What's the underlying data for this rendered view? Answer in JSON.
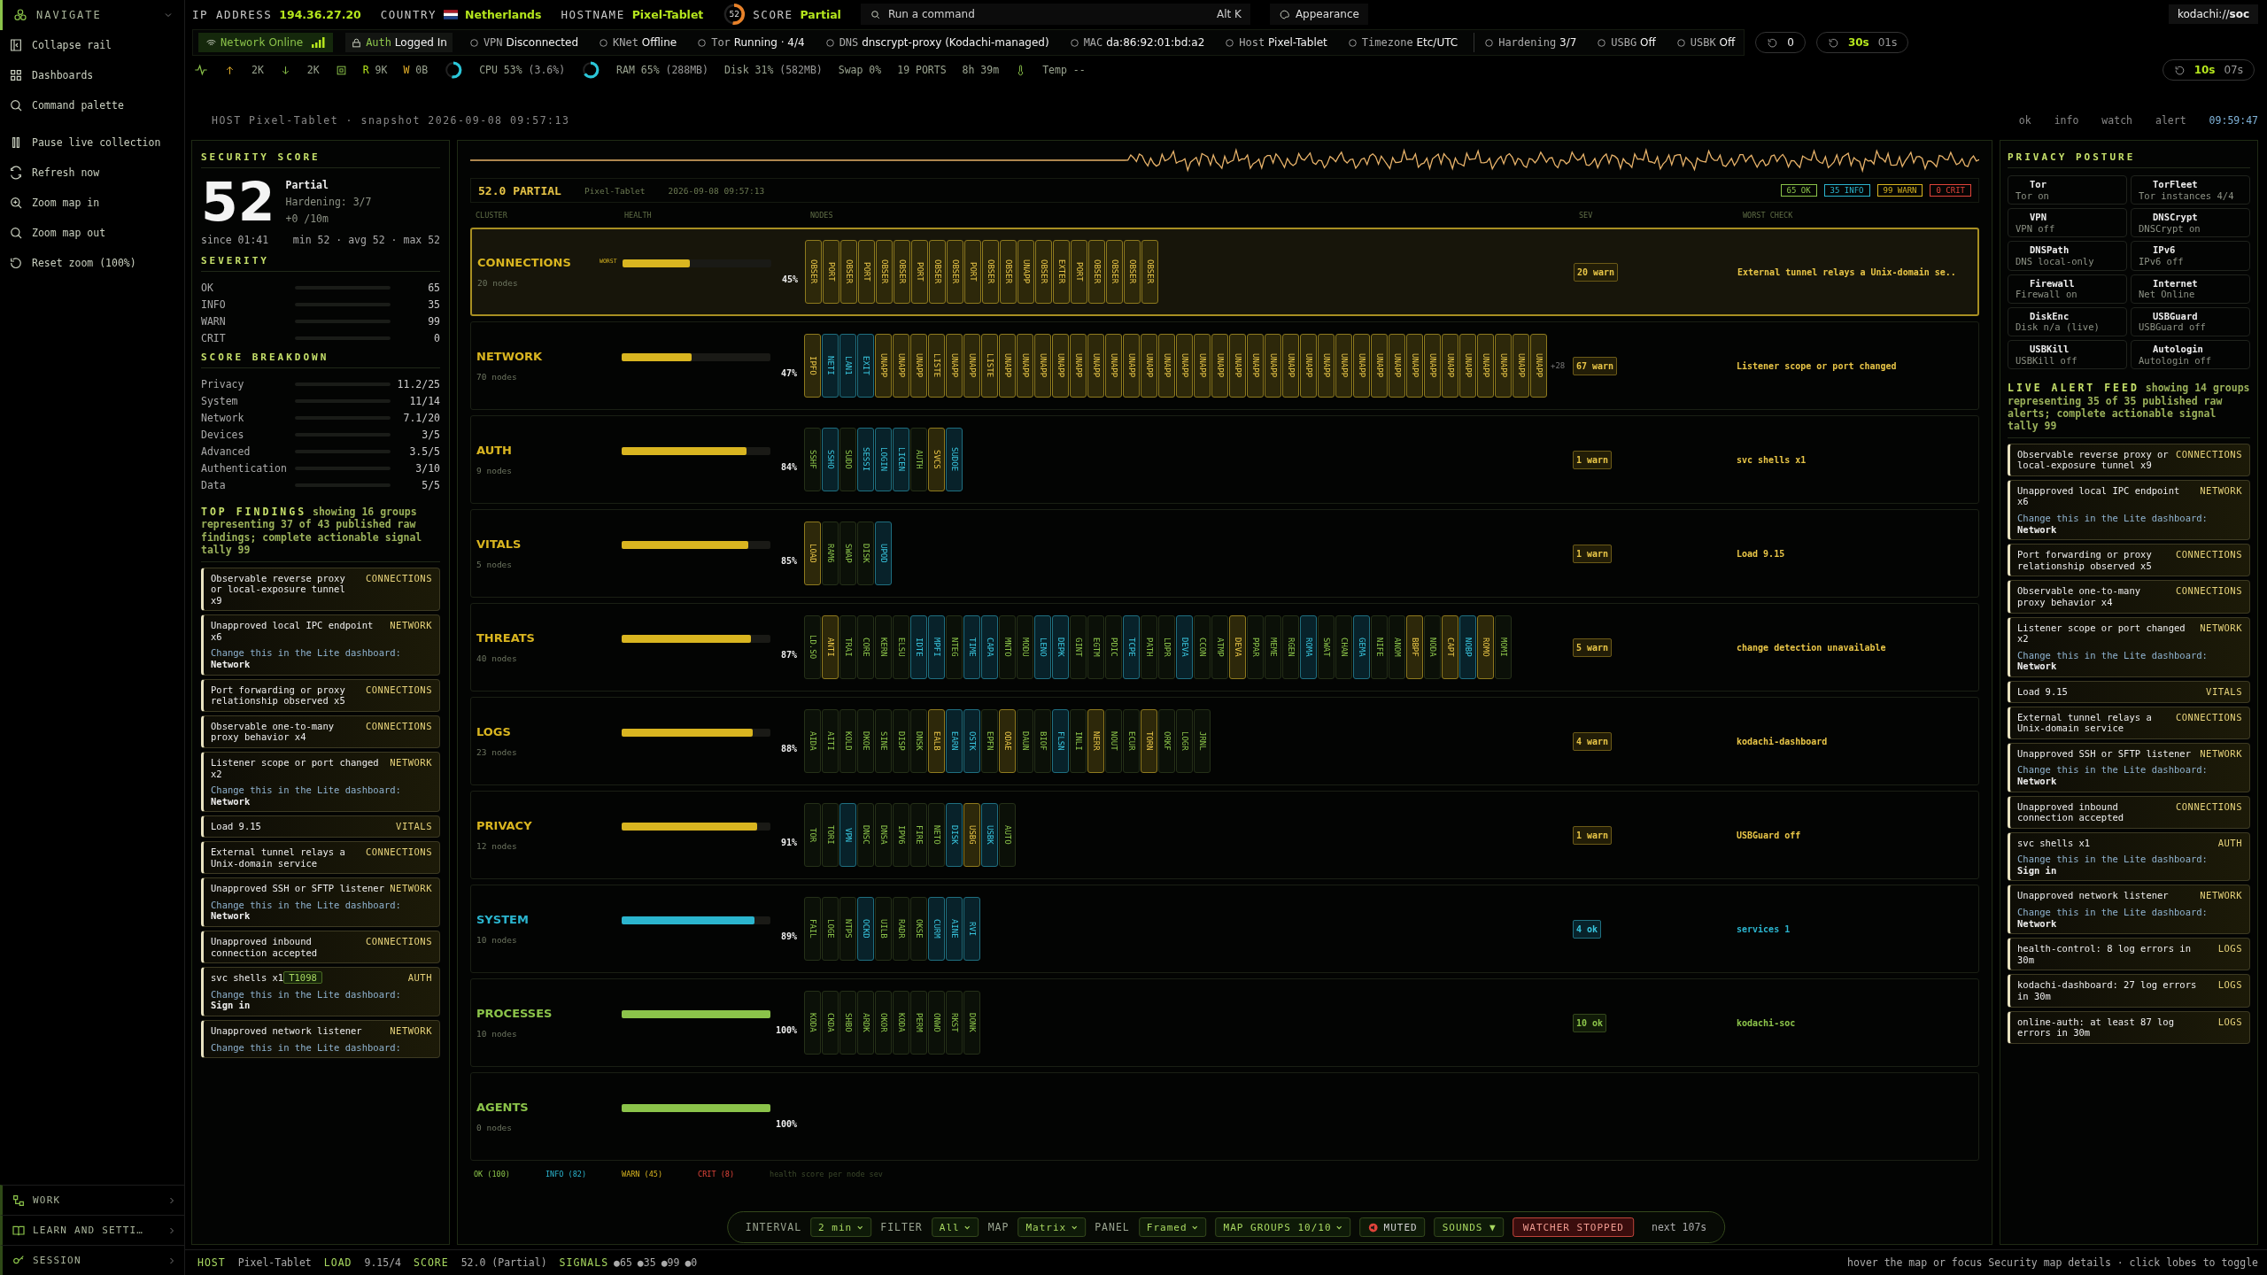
{
  "nav": {
    "title": "NAVIGATE",
    "items": [
      "Collapse rail",
      "Dashboards",
      "Command palette",
      "Pause live collection",
      "Refresh now",
      "Zoom map in",
      "Zoom map out",
      "Reset zoom (100%)"
    ],
    "sections": [
      "WORK",
      "LEARN AND SETTI…",
      "SESSION"
    ]
  },
  "topbar": {
    "fields": [
      {
        "label": "IP ADDRESS",
        "value": "194.36.27.20"
      },
      {
        "label": "COUNTRY",
        "value": "Netherlands"
      },
      {
        "label": "HOSTNAME",
        "value": "Pixel-Tablet"
      }
    ],
    "score": {
      "value": "52",
      "label": "SCORE",
      "status": "Partial",
      "level": 0.52
    },
    "command": {
      "placeholder": "Run a command",
      "shortcut": "Alt K"
    },
    "appearance": "Appearance",
    "brand": "kodachi://**soc**"
  },
  "chips": [
    {
      "label": "Network",
      "value": "Online",
      "kind": "online"
    },
    {
      "label": "Auth",
      "value": "Logged In",
      "kind": "ok"
    },
    {
      "label": "VPN",
      "value": "Disconnected",
      "kind": "plain"
    },
    {
      "label": "KNet",
      "value": "Offline",
      "kind": "plain"
    },
    {
      "label": "Tor",
      "value": "Running · 4/4",
      "kind": "plain"
    },
    {
      "label": "DNS",
      "value": "dnscrypt-proxy (Kodachi-managed)",
      "kind": "plain"
    },
    {
      "label": "MAC",
      "value": "da:86:92:01:bd:a2",
      "kind": "plain"
    },
    {
      "label": "Host",
      "value": "Pixel-Tablet",
      "kind": "plain"
    },
    {
      "label": "Timezone",
      "value": "Etc/UTC",
      "kind": "plain"
    },
    {
      "label": "Hardening",
      "value": "3/7",
      "kind": "plain"
    },
    {
      "label": "USBG",
      "value": "Off",
      "kind": "plain"
    },
    {
      "label": "USBK",
      "value": "Off",
      "kind": "plain"
    }
  ],
  "refresh_count": "0",
  "timer": {
    "interval": "30s",
    "remaining": "01s"
  },
  "metrics": {
    "up": "2K",
    "down": "2K",
    "read_label": "R",
    "read": "9K",
    "write_label": "W",
    "write": "0B",
    "cpu": {
      "label": "CPU",
      "value": "53%",
      "detail": "(3.6%)",
      "level": 0.53
    },
    "ram": {
      "label": "RAM",
      "value": "65%",
      "detail": "(288MB)",
      "level": 0.65
    },
    "disk": {
      "label": "Disk",
      "value": "31%",
      "detail": "(582MB)"
    },
    "swap": {
      "label": "Swap",
      "value": "0%"
    },
    "ports": {
      "value": "19",
      "label": "PORTS"
    },
    "uptime": "8h 39m",
    "temp": {
      "label": "Temp",
      "value": "--"
    },
    "timer": {
      "interval": "10s",
      "remaining": "07s"
    }
  },
  "snapshot": {
    "text": "HOST Pixel-Tablet · snapshot 2026-09-08 09:57:13",
    "legend": [
      "ok",
      "info",
      "watch",
      "alert"
    ],
    "time": "09:59:47"
  },
  "security": {
    "title": "SECURITY SCORE",
    "score": "52",
    "status": "Partial",
    "hardening": "Hardening: 3/7",
    "trend": "+0 /10m",
    "since": "since 01:41",
    "stats": "min 52 · avg 52 · max 52",
    "severity_title": "SEVERITY",
    "severity": [
      {
        "label": "OK",
        "value": "65"
      },
      {
        "label": "INFO",
        "value": "35"
      },
      {
        "label": "WARN",
        "value": "99"
      },
      {
        "label": "CRIT",
        "value": "0"
      }
    ],
    "breakdown_title": "SCORE BREAKDOWN",
    "breakdown": [
      {
        "label": "Privacy",
        "value": "11.2/25"
      },
      {
        "label": "System",
        "value": "11/14"
      },
      {
        "label": "Network",
        "value": "7.1/20"
      },
      {
        "label": "Devices",
        "value": "3/5"
      },
      {
        "label": "Advanced",
        "value": "3.5/5"
      },
      {
        "label": "Authentication",
        "value": "3/10"
      },
      {
        "label": "Data",
        "value": "5/5"
      }
    ]
  },
  "findings": {
    "title": "TOP FINDINGS",
    "note": "showing 16 groups representing 37 of 43 published raw findings; complete actionable signal tally 99",
    "items": [
      {
        "title": "Observable reverse proxy or local-exposure tunnel x9",
        "category": "CONNECTIONS"
      },
      {
        "title": "Unapproved local IPC endpoint x6",
        "category": "NETWORK",
        "hint": "Change this in the Lite dashboard:",
        "target": "Network"
      },
      {
        "title": "Port forwarding or proxy relationship observed x5",
        "category": "CONNECTIONS"
      },
      {
        "title": "Observable one-to-many proxy behavior x4",
        "category": "CONNECTIONS"
      },
      {
        "title": "Listener scope or port changed x2",
        "category": "NETWORK",
        "hint": "Change this in the Lite dashboard:",
        "target": "Network"
      },
      {
        "title": "Load 9.15",
        "category": "VITALS"
      },
      {
        "title": "External tunnel relays a Unix-domain service",
        "category": "CONNECTIONS"
      },
      {
        "title": "Unapproved SSH or SFTP listener",
        "category": "NETWORK",
        "hint": "Change this in the Lite dashboard:",
        "target": "Network"
      },
      {
        "title": "Unapproved inbound connection accepted",
        "category": "CONNECTIONS"
      },
      {
        "title": "svc shells x1",
        "tag": "T1098",
        "category": "AUTH",
        "hint": "Change this in the Lite dashboard:",
        "target": "Sign in"
      },
      {
        "title": "Unapproved network listener",
        "category": "NETWORK",
        "hint": "Change this in the Lite dashboard:"
      }
    ]
  },
  "map": {
    "score_label": "52.0 PARTIAL",
    "host": "Pixel-Tablet",
    "time": "2026-09-08 09:57:13",
    "badges": [
      {
        "label": "65 OK",
        "kind": "ok"
      },
      {
        "label": "35 INFO",
        "kind": "info"
      },
      {
        "label": "99 WARN",
        "kind": "warn"
      },
      {
        "label": "0 CRIT",
        "kind": "crit"
      }
    ],
    "columns": [
      "CLUSTER",
      "HEALTH",
      "NODES",
      "SEV",
      "WORST CHECK"
    ],
    "clusters": [
      {
        "name": "CONNECTIONS",
        "nodes_label": "20 nodes",
        "kind": "warn",
        "level": 0.45,
        "pct": "45%",
        "sev": "20 warn",
        "worst": "External tunnel relays a Unix-domain se..",
        "selected": true,
        "flag": "WORST",
        "nodes": [
          {
            "label": "OBSER",
            "kind": "warn"
          },
          {
            "label": "PORT",
            "kind": "warn"
          },
          {
            "label": "OBSER",
            "kind": "warn"
          },
          {
            "label": "PORT",
            "kind": "warn"
          },
          {
            "label": "OBSER",
            "kind": "warn"
          },
          {
            "label": "OBSER",
            "kind": "warn"
          },
          {
            "label": "PORT",
            "kind": "warn"
          },
          {
            "label": "OBSER",
            "kind": "warn"
          },
          {
            "label": "OBSER",
            "kind": "warn"
          },
          {
            "label": "PORT",
            "kind": "warn"
          },
          {
            "label": "OBSER",
            "kind": "warn"
          },
          {
            "label": "OBSER",
            "kind": "warn"
          },
          {
            "label": "UNAPP",
            "kind": "warn"
          },
          {
            "label": "OBSER",
            "kind": "warn"
          },
          {
            "label": "EXTER",
            "kind": "warn"
          },
          {
            "label": "PORT",
            "kind": "warn"
          },
          {
            "label": "OBSER",
            "kind": "warn"
          },
          {
            "label": "OBSER",
            "kind": "warn"
          },
          {
            "label": "OBSER",
            "kind": "warn"
          },
          {
            "label": "OBSER",
            "kind": "warn"
          }
        ]
      },
      {
        "name": "NETWORK",
        "nodes_label": "70 nodes",
        "kind": "warn",
        "level": 0.47,
        "pct": "47%",
        "sev": "67 warn",
        "worst": "Listener scope or port changed",
        "selected": false,
        "more": "+28",
        "nodes": [
          {
            "label": "IPFO",
            "kind": "warn"
          },
          {
            "label": "NETI",
            "kind": "info"
          },
          {
            "label": "LAN1",
            "kind": "info"
          },
          {
            "label": "EXIT",
            "kind": "info"
          },
          {
            "label": "UNAPP",
            "kind": "warn"
          },
          {
            "label": "UNAPP",
            "kind": "warn"
          },
          {
            "label": "UNAPP",
            "kind": "warn"
          },
          {
            "label": "LISTE",
            "kind": "warn"
          },
          {
            "label": "UNAPP",
            "kind": "warn"
          },
          {
            "label": "UNAPP",
            "kind": "warn"
          },
          {
            "label": "LISTE",
            "kind": "warn"
          },
          {
            "label": "UNAPP",
            "kind": "warn"
          },
          {
            "label": "UNAPP",
            "kind": "warn"
          },
          {
            "label": "UNAPP",
            "kind": "warn"
          },
          {
            "label": "UNAPP",
            "kind": "warn"
          },
          {
            "label": "UNAPP",
            "kind": "warn"
          },
          {
            "label": "UNAPP",
            "kind": "warn"
          },
          {
            "label": "UNAPP",
            "kind": "warn"
          },
          {
            "label": "UNAPP",
            "kind": "warn"
          },
          {
            "label": "UNAPP",
            "kind": "warn"
          },
          {
            "label": "UNAPP",
            "kind": "warn"
          },
          {
            "label": "UNAPP",
            "kind": "warn"
          },
          {
            "label": "UNAPP",
            "kind": "warn"
          },
          {
            "label": "UNAPP",
            "kind": "warn"
          },
          {
            "label": "UNAPP",
            "kind": "warn"
          },
          {
            "label": "UNAPP",
            "kind": "warn"
          },
          {
            "label": "UNAPP",
            "kind": "warn"
          },
          {
            "label": "UNAPP",
            "kind": "warn"
          },
          {
            "label": "UNAPP",
            "kind": "warn"
          },
          {
            "label": "UNAPP",
            "kind": "warn"
          },
          {
            "label": "UNAPP",
            "kind": "warn"
          },
          {
            "label": "UNAPP",
            "kind": "warn"
          },
          {
            "label": "UNAPP",
            "kind": "warn"
          },
          {
            "label": "UNAPP",
            "kind": "warn"
          },
          {
            "label": "UNAPP",
            "kind": "warn"
          },
          {
            "label": "UNAPP",
            "kind": "warn"
          },
          {
            "label": "UNAPP",
            "kind": "warn"
          },
          {
            "label": "UNAPP",
            "kind": "warn"
          },
          {
            "label": "UNAPP",
            "kind": "warn"
          },
          {
            "label": "UNAPP",
            "kind": "warn"
          },
          {
            "label": "UNAPP",
            "kind": "warn"
          },
          {
            "label": "UNAPP",
            "kind": "warn"
          }
        ]
      },
      {
        "name": "AUTH",
        "nodes_label": "9 nodes",
        "kind": "warn",
        "level": 0.84,
        "pct": "84%",
        "sev": "1 warn",
        "worst": "svc shells x1",
        "selected": false,
        "nodes": [
          {
            "label": "SSHF",
            "kind": "ok"
          },
          {
            "label": "SSHO",
            "kind": "info"
          },
          {
            "label": "SUDO",
            "kind": "ok"
          },
          {
            "label": "SESSI",
            "kind": "info"
          },
          {
            "label": "LOGIN",
            "kind": "info"
          },
          {
            "label": "LICEN",
            "kind": "info"
          },
          {
            "label": "AUTH",
            "kind": "ok"
          },
          {
            "label": "SVCS",
            "kind": "warn"
          },
          {
            "label": "SUDOE",
            "kind": "info"
          }
        ]
      },
      {
        "name": "VITALS",
        "nodes_label": "5 nodes",
        "kind": "warn",
        "level": 0.85,
        "pct": "85%",
        "sev": "1 warn",
        "worst": "Load 9.15",
        "selected": false,
        "nodes": [
          {
            "label": "LOAD",
            "kind": "warn"
          },
          {
            "label": "RAM6",
            "kind": "ok"
          },
          {
            "label": "SWAP",
            "kind": "ok"
          },
          {
            "label": "DISK",
            "kind": "ok"
          },
          {
            "label": "UPOD",
            "kind": "info"
          }
        ]
      },
      {
        "name": "THREATS",
        "nodes_label": "40 nodes",
        "kind": "warn",
        "level": 0.87,
        "pct": "87%",
        "sev": "5 warn",
        "worst": "change detection unavailable",
        "selected": false,
        "nodes": [
          {
            "label": "LD.SO",
            "kind": "ok"
          },
          {
            "label": "ANTI",
            "kind": "warn"
          },
          {
            "label": "TRAI",
            "kind": "ok"
          },
          {
            "label": "CORE",
            "kind": "ok"
          },
          {
            "label": "KERN",
            "kind": "ok"
          },
          {
            "label": "ELSU",
            "kind": "ok"
          },
          {
            "label": "IDTE",
            "kind": "info"
          },
          {
            "label": "MPFI",
            "kind": "info"
          },
          {
            "label": "NTEG",
            "kind": "ok"
          },
          {
            "label": "TIME",
            "kind": "info"
          },
          {
            "label": "CAPA",
            "kind": "info"
          },
          {
            "label": "MNTO",
            "kind": "ok"
          },
          {
            "label": "MODU",
            "kind": "ok"
          },
          {
            "label": "LENO",
            "kind": "info"
          },
          {
            "label": "DEPK",
            "kind": "info"
          },
          {
            "label": "GINT",
            "kind": "ok"
          },
          {
            "label": "EGTM",
            "kind": "ok"
          },
          {
            "label": "PDIC",
            "kind": "ok"
          },
          {
            "label": "TCPE",
            "kind": "info"
          },
          {
            "label": "PATH",
            "kind": "ok"
          },
          {
            "label": "LDPR",
            "kind": "ok"
          },
          {
            "label": "DEVA",
            "kind": "info"
          },
          {
            "label": "CCON",
            "kind": "ok"
          },
          {
            "label": "ATMP",
            "kind": "ok"
          },
          {
            "label": "DEVA",
            "kind": "warn"
          },
          {
            "label": "PPAR",
            "kind": "ok"
          },
          {
            "label": "MEME",
            "kind": "ok"
          },
          {
            "label": "RGEN",
            "kind": "ok"
          },
          {
            "label": "ROMA",
            "kind": "info"
          },
          {
            "label": "SWAT",
            "kind": "ok"
          },
          {
            "label": "CHAN",
            "kind": "ok"
          },
          {
            "label": "GEMA",
            "kind": "info"
          },
          {
            "label": "NIFE",
            "kind": "ok"
          },
          {
            "label": "ANOM",
            "kind": "ok"
          },
          {
            "label": "BBPF",
            "kind": "warn"
          },
          {
            "label": "NODA",
            "kind": "ok"
          },
          {
            "label": "CAPT",
            "kind": "warn"
          },
          {
            "label": "NOBP",
            "kind": "info"
          },
          {
            "label": "ROMO",
            "kind": "warn"
          },
          {
            "label": "MOMI",
            "kind": "ok"
          }
        ]
      },
      {
        "name": "LOGS",
        "nodes_label": "23 nodes",
        "kind": "warn",
        "level": 0.88,
        "pct": "88%",
        "sev": "4 warn",
        "worst": "kodachi-dashboard",
        "selected": false,
        "nodes": [
          {
            "label": "AIDA",
            "kind": "ok"
          },
          {
            "label": "AITI",
            "kind": "ok"
          },
          {
            "label": "KOLD",
            "kind": "ok"
          },
          {
            "label": "DKOE",
            "kind": "ok"
          },
          {
            "label": "SINE",
            "kind": "ok"
          },
          {
            "label": "DISP",
            "kind": "ok"
          },
          {
            "label": "DNSK",
            "kind": "ok"
          },
          {
            "label": "EALB",
            "kind": "warn"
          },
          {
            "label": "EARN",
            "kind": "info"
          },
          {
            "label": "OSTK",
            "kind": "info"
          },
          {
            "label": "EPFN",
            "kind": "ok"
          },
          {
            "label": "ODAE",
            "kind": "warn"
          },
          {
            "label": "DAUN",
            "kind": "ok"
          },
          {
            "label": "BIOF",
            "kind": "ok"
          },
          {
            "label": "FLSN",
            "kind": "info"
          },
          {
            "label": "INLI",
            "kind": "ok"
          },
          {
            "label": "NERR",
            "kind": "warn"
          },
          {
            "label": "NOUT",
            "kind": "ok"
          },
          {
            "label": "ECUR",
            "kind": "ok"
          },
          {
            "label": "TORN",
            "kind": "warn"
          },
          {
            "label": "ORKF",
            "kind": "ok"
          },
          {
            "label": "LOGR",
            "kind": "ok"
          },
          {
            "label": "JRNL",
            "kind": "ok"
          }
        ]
      },
      {
        "name": "PRIVACY",
        "nodes_label": "12 nodes",
        "kind": "warn",
        "level": 0.91,
        "pct": "91%",
        "sev": "1 warn",
        "worst": "USBGuard off",
        "selected": false,
        "nodes": [
          {
            "label": "TOR",
            "kind": "ok"
          },
          {
            "label": "TORI",
            "kind": "ok"
          },
          {
            "label": "VPN",
            "kind": "info"
          },
          {
            "label": "DNSC",
            "kind": "ok"
          },
          {
            "label": "DNSA",
            "kind": "ok"
          },
          {
            "label": "IPV6",
            "kind": "ok"
          },
          {
            "label": "FIRE",
            "kind": "ok"
          },
          {
            "label": "NETO",
            "kind": "ok"
          },
          {
            "label": "DISK",
            "kind": "info"
          },
          {
            "label": "USBG",
            "kind": "warn"
          },
          {
            "label": "USBK",
            "kind": "info"
          },
          {
            "label": "AUTO",
            "kind": "ok"
          }
        ]
      },
      {
        "name": "SYSTEM",
        "nodes_label": "10 nodes",
        "kind": "info",
        "level": 0.89,
        "pct": "89%",
        "sev": "4 ok",
        "worst": "services 1",
        "selected": false,
        "nodes": [
          {
            "label": "FAIL",
            "kind": "ok"
          },
          {
            "label": "LOGE",
            "kind": "ok"
          },
          {
            "label": "NTPS",
            "kind": "ok"
          },
          {
            "label": "OCKD",
            "kind": "info"
          },
          {
            "label": "UILB",
            "kind": "ok"
          },
          {
            "label": "RADR",
            "kind": "ok"
          },
          {
            "label": "OKSE",
            "kind": "ok"
          },
          {
            "label": "CURM",
            "kind": "info"
          },
          {
            "label": "AINE",
            "kind": "info"
          },
          {
            "label": "RVI",
            "kind": "info"
          }
        ]
      },
      {
        "name": "PROCESSES",
        "nodes_label": "10 nodes",
        "kind": "ok",
        "level": 1,
        "pct": "100%",
        "sev": "10 ok",
        "worst": "kodachi-soc",
        "selected": false,
        "nodes": [
          {
            "label": "KODA",
            "kind": "ok"
          },
          {
            "label": "CKDA",
            "kind": "ok"
          },
          {
            "label": "SHBO",
            "kind": "ok"
          },
          {
            "label": "ARDK",
            "kind": "ok"
          },
          {
            "label": "OKOR",
            "kind": "ok"
          },
          {
            "label": "KODA",
            "kind": "ok"
          },
          {
            "label": "PERM",
            "kind": "ok"
          },
          {
            "label": "ONWO",
            "kind": "ok"
          },
          {
            "label": "RKST",
            "kind": "ok"
          },
          {
            "label": "DONK",
            "kind": "ok"
          }
        ]
      },
      {
        "name": "AGENTS",
        "nodes_label": "0 nodes",
        "kind": "ok",
        "level": 1,
        "pct": "100%",
        "selected": false
      }
    ],
    "legend": [
      {
        "label": "OK (100)",
        "kind": "ok"
      },
      {
        "label": "INFO (82)",
        "kind": "info"
      },
      {
        "label": "WARN (45)",
        "kind": "warn"
      },
      {
        "label": "CRIT (8)",
        "kind": "crit"
      },
      {
        "label": "health score per node sev",
        "kind": "note"
      }
    ]
  },
  "privacy": {
    "title": "PRIVACY POSTURE",
    "items": [
      {
        "name": "Tor",
        "status": "Tor on"
      },
      {
        "name": "TorFleet",
        "status": "Tor instances 4/4"
      },
      {
        "name": "VPN",
        "status": "VPN off"
      },
      {
        "name": "DNSCrypt",
        "status": "DNSCrypt on"
      },
      {
        "name": "DNSPath",
        "status": "DNS local-only"
      },
      {
        "name": "IPv6",
        "status": "IPv6 off"
      },
      {
        "name": "Firewall",
        "status": "Firewall on"
      },
      {
        "name": "Internet",
        "status": "Net Online"
      },
      {
        "name": "DiskEnc",
        "status": "Disk n/a (live)"
      },
      {
        "name": "USBGuard",
        "status": "USBGuard off"
      },
      {
        "name": "USBKill",
        "status": "USBKill off"
      },
      {
        "name": "Autologin",
        "status": "Autologin off"
      }
    ]
  },
  "alerts": {
    "title": "LIVE ALERT FEED",
    "note": "showing 14 groups representing 35 of 35 published raw alerts; complete actionable signal tally 99",
    "items": [
      {
        "title": "Observable reverse proxy or local-exposure tunnel x9",
        "category": "CONNECTIONS"
      },
      {
        "title": "Unapproved local IPC endpoint x6",
        "category": "NETWORK",
        "hint": "Change this in the Lite dashboard:",
        "target": "Network"
      },
      {
        "title": "Port forwarding or proxy relationship observed x5",
        "category": "CONNECTIONS"
      },
      {
        "title": "Observable one-to-many proxy behavior x4",
        "category": "CONNECTIONS"
      },
      {
        "title": "Listener scope or port changed x2",
        "category": "NETWORK",
        "hint": "Change this in the Lite dashboard:",
        "target": "Network"
      },
      {
        "title": "Load 9.15",
        "category": "VITALS"
      },
      {
        "title": "External tunnel relays a Unix-domain service",
        "category": "CONNECTIONS"
      },
      {
        "title": "Unapproved SSH or SFTP listener",
        "category": "NETWORK",
        "hint": "Change this in the Lite dashboard:",
        "target": "Network"
      },
      {
        "title": "Unapproved inbound connection accepted",
        "category": "CONNECTIONS"
      },
      {
        "title": "svc shells x1",
        "category": "AUTH",
        "hint": "Change this in the Lite dashboard:",
        "target": "Sign in"
      },
      {
        "title": "Unapproved network listener",
        "category": "NETWORK",
        "hint": "Change this in the Lite dashboard:",
        "target": "Network"
      },
      {
        "title": "health-control: 8 log errors in 30m",
        "category": "LOGS"
      },
      {
        "title": "kodachi-dashboard: 27 log errors in 30m",
        "category": "LOGS"
      },
      {
        "title": "online-auth: at least 87 log errors in 30m",
        "category": "LOGS"
      }
    ]
  },
  "controls": {
    "selects": [
      {
        "label": "INTERVAL",
        "value": "2 min"
      },
      {
        "label": "FILTER",
        "value": "All"
      },
      {
        "label": "MAP",
        "value": "Matrix"
      },
      {
        "label": "PANEL",
        "value": "Framed"
      }
    ],
    "map_groups": "MAP GROUPS 10/10",
    "muted": {
      "label": "MUTED",
      "on": true
    },
    "sounds": "SOUNDS ▼",
    "watcher": "WATCHER STOPPED",
    "next": "next 107s"
  },
  "status_bar": {
    "items": [
      {
        "label": "HOST",
        "value": "Pixel-Tablet"
      },
      {
        "label": "LOAD",
        "value": "9.15/4"
      },
      {
        "label": "SCORE",
        "value": "52.0 (Partial)"
      }
    ],
    "signals_label": "SIGNALS",
    "signals": [
      "●65",
      "●35",
      "●99",
      "●0"
    ],
    "hint": "hover the map or focus Security map details · click lobes to toggle"
  }
}
